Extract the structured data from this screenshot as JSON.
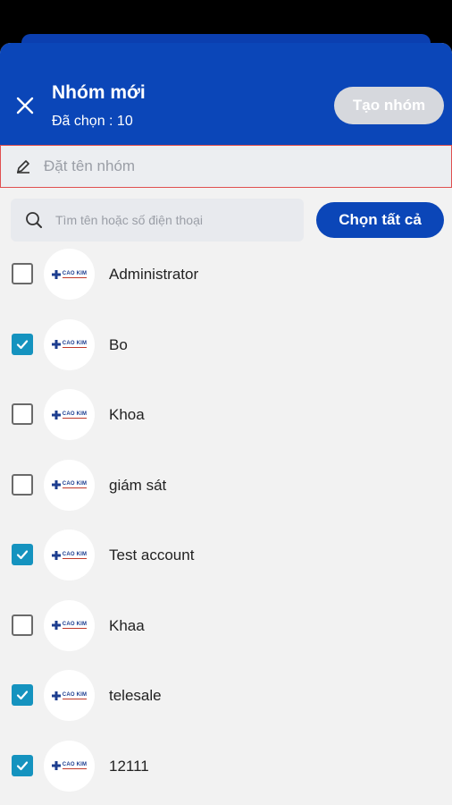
{
  "header": {
    "title": "Nhóm mới",
    "subtitle": "Đã chọn : 10",
    "create_label": "Tạo nhóm",
    "close_icon": "close-icon"
  },
  "group_name": {
    "placeholder": "Đặt tên nhóm",
    "icon": "pencil-icon"
  },
  "search": {
    "placeholder": "Tìm tên hoặc số điện thoại",
    "icon": "search-icon"
  },
  "select_all_label": "Chọn tất cả",
  "avatar_logo_text": "CAO KIM",
  "colors": {
    "brand": "#0b46b8",
    "checkbox_checked": "#1593bf",
    "error_border": "#e05050"
  },
  "contacts": [
    {
      "name": "Administrator",
      "checked": false
    },
    {
      "name": "Bo",
      "checked": true
    },
    {
      "name": "Khoa",
      "checked": false
    },
    {
      "name": "giám sát",
      "checked": false
    },
    {
      "name": "Test account",
      "checked": true
    },
    {
      "name": "Khaa",
      "checked": false
    },
    {
      "name": "telesale",
      "checked": true
    },
    {
      "name": "12111",
      "checked": true
    }
  ]
}
